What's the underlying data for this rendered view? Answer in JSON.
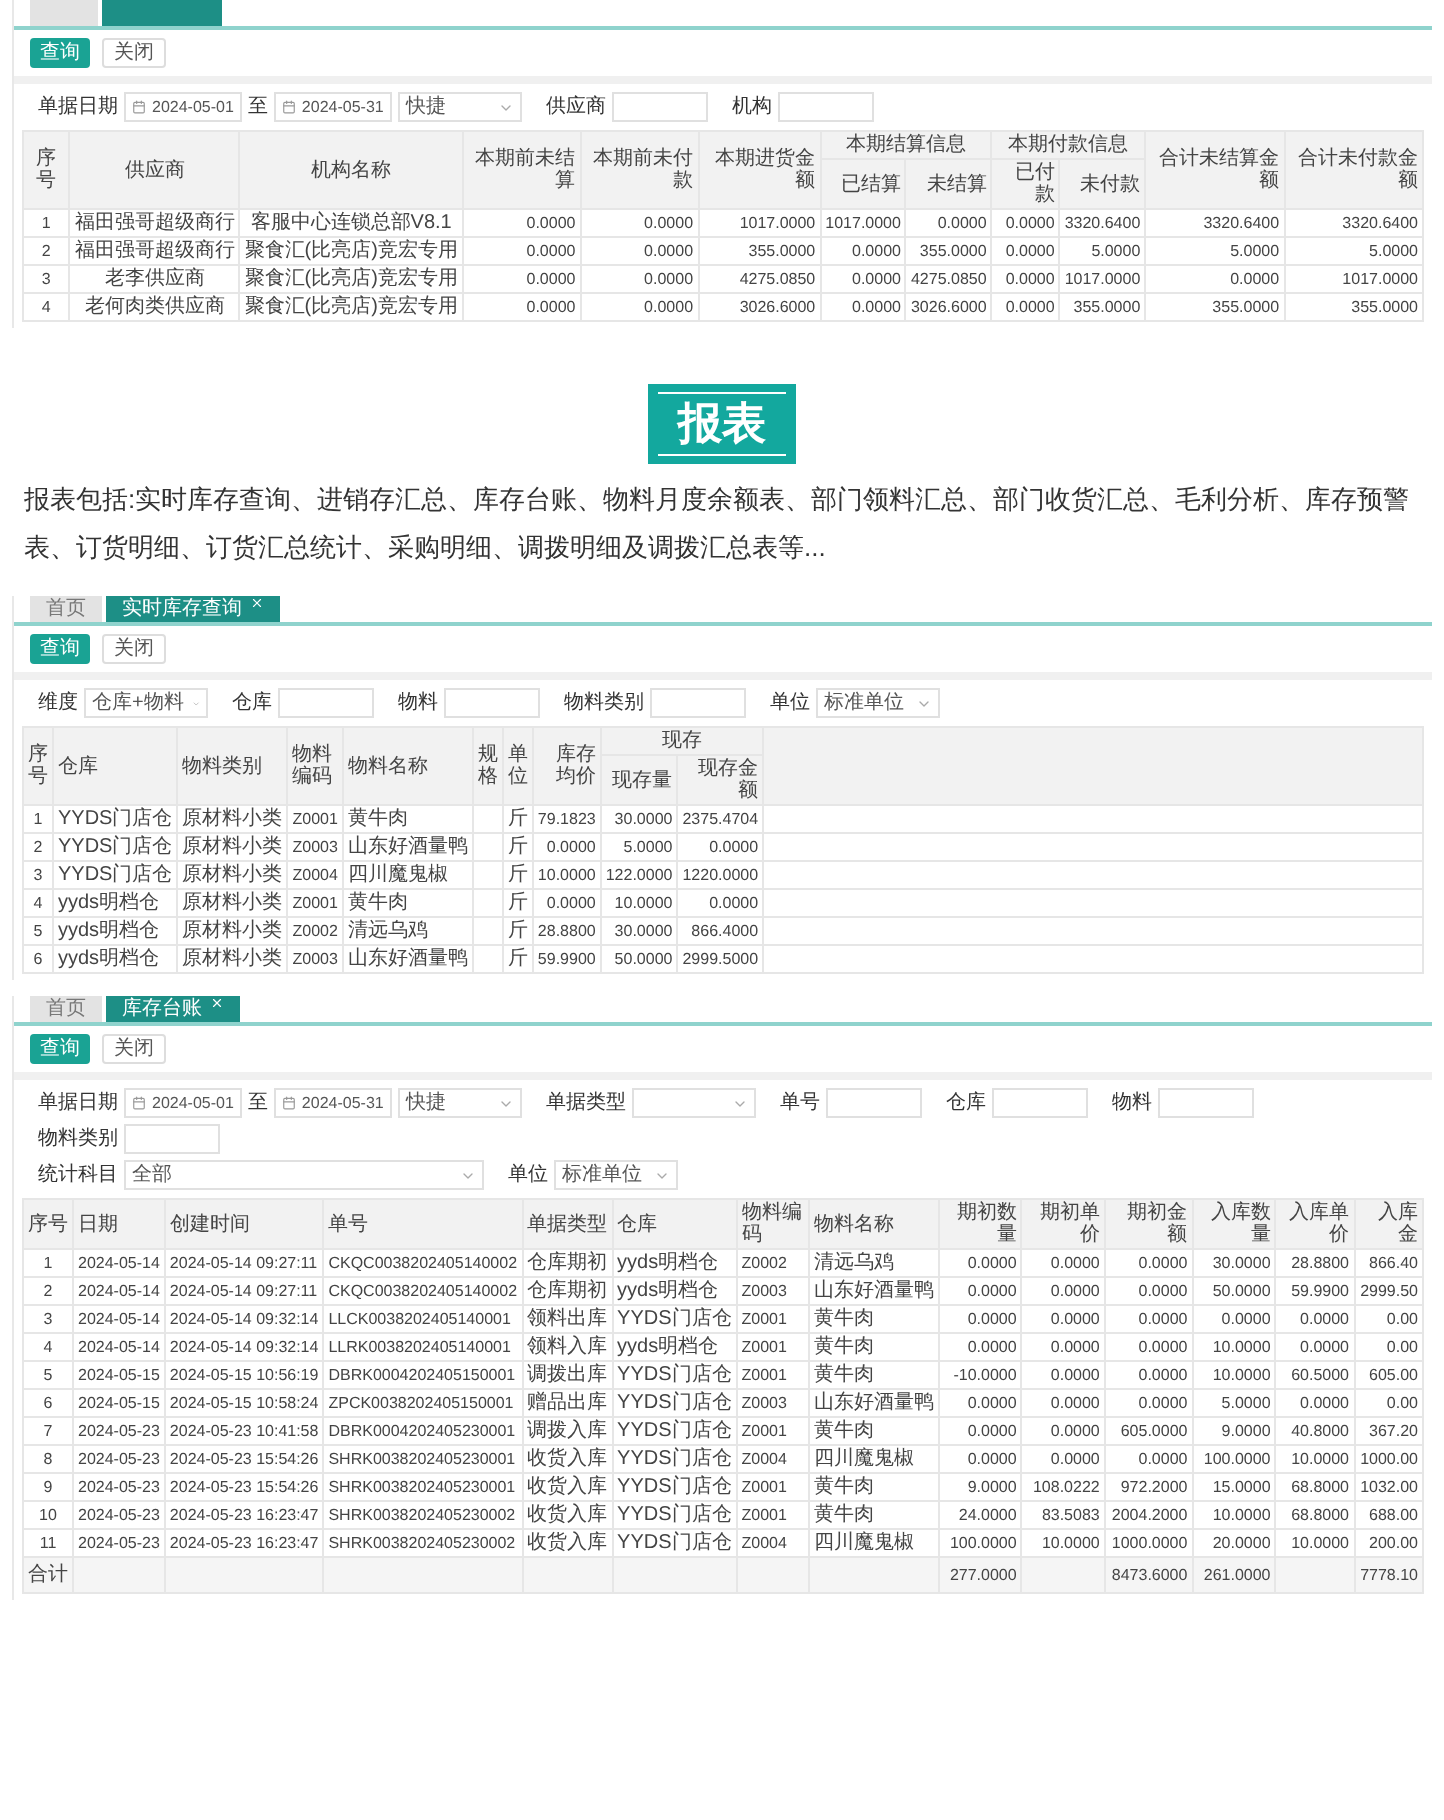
{
  "screens": [
    {
      "tabs": [
        {
          "selected": false,
          "closable": false
        },
        {
          "selected": true,
          "closable": false
        }
      ],
      "buttons": [
        {
          "label": "查询",
          "primary": true
        },
        {
          "label": "关闭",
          "primary": false
        }
      ],
      "filters": [
        [
          {
            "kind": "date_range",
            "label": "单据日期",
            "from": "2024-05-01",
            "to_label": "至",
            "to": "2024-05-31",
            "quick": "快捷"
          },
          {
            "kind": "input",
            "label": "供应商"
          },
          {
            "kind": "input",
            "label": "机构"
          }
        ]
      ],
      "table": {
        "centered": true,
        "filler_column": false,
        "total_row": false,
        "column_groups": [
          {
            "label": "本期结算信息"
          },
          {
            "label": "本期付款信息"
          }
        ],
        "columns": [
          {
            "label": "序号",
            "grouped": false
          },
          {
            "label": "供应商",
            "grouped": false
          },
          {
            "label": "机构名称",
            "grouped": false
          },
          {
            "label": "本期前未结算",
            "grouped": false
          },
          {
            "label": "本期前未付款",
            "grouped": false
          },
          {
            "label": "本期进货金额",
            "grouped": false
          },
          {
            "label": "已结算",
            "grouped": true,
            "group_start": true
          },
          {
            "label": "未结算",
            "grouped": true,
            "group_start": false
          },
          {
            "label": "已付款",
            "grouped": true,
            "group_start": true
          },
          {
            "label": "未付款",
            "grouped": true,
            "group_start": false
          },
          {
            "label": "合计未结算金额",
            "grouped": false
          },
          {
            "label": "合计未付款金额",
            "grouped": false
          }
        ],
        "rows": [
          [
            "1",
            "福田强哥超级商行",
            "客服中心连锁总部V8.1",
            "0.0000",
            "0.0000",
            "1017.0000",
            "1017.0000",
            "0.0000",
            "0.0000",
            "3320.6400",
            "3320.6400",
            "3320.6400"
          ],
          [
            "2",
            "福田强哥超级商行",
            "聚食汇(比亮店)竞宏专用",
            "0.0000",
            "0.0000",
            "355.0000",
            "0.0000",
            "355.0000",
            "0.0000",
            "5.0000",
            "5.0000",
            "5.0000"
          ],
          [
            "3",
            "老李供应商",
            "聚食汇(比亮店)竞宏专用",
            "0.0000",
            "0.0000",
            "4275.0850",
            "0.0000",
            "4275.0850",
            "0.0000",
            "1017.0000",
            "0.0000",
            "1017.0000"
          ],
          [
            "4",
            "老何肉类供应商",
            "聚食汇(比亮店)竞宏专用",
            "0.0000",
            "0.0000",
            "3026.6000",
            "0.0000",
            "3026.6000",
            "0.0000",
            "355.0000",
            "355.0000",
            "355.0000"
          ]
        ]
      }
    },
    {
      "heading": "报表",
      "text": "报表包括:实时库存查询、进销存汇总、库存台账、物料月度余额表、部门领料汇总、部门收货汇总、毛利分析、库存预警表、订货明细、订货汇总统计、采购明细、调拨明细及调拨汇总表等..."
    },
    {
      "tabs": [
        {
          "label": "首页",
          "selected": false,
          "closable": false
        },
        {
          "label": "实时库存查询",
          "selected": true,
          "closable": true
        }
      ],
      "buttons": [
        {
          "label": "查询",
          "primary": true
        },
        {
          "label": "关闭",
          "primary": false
        }
      ],
      "filters": [
        [
          {
            "kind": "select",
            "label": "维度",
            "value": "仓库+物料",
            "wide": false
          },
          {
            "kind": "input",
            "label": "仓库"
          },
          {
            "kind": "input",
            "label": "物料"
          },
          {
            "kind": "input",
            "label": "物料类别"
          },
          {
            "kind": "select",
            "label": "单位",
            "value": "标准单位",
            "wide": false
          }
        ]
      ],
      "table": {
        "centered": false,
        "filler_column": true,
        "total_row": false,
        "column_groups": [
          {
            "label": "现存"
          }
        ],
        "columns": [
          {
            "label": "序号",
            "grouped": false
          },
          {
            "label": "仓库",
            "grouped": false
          },
          {
            "label": "物料类别",
            "grouped": false
          },
          {
            "label": "物料编码",
            "grouped": false
          },
          {
            "label": "物料名称",
            "grouped": false
          },
          {
            "label": "规格",
            "grouped": false
          },
          {
            "label": "单位",
            "grouped": false
          },
          {
            "label": "库存均价",
            "grouped": false
          },
          {
            "label": "现存量",
            "grouped": true,
            "group_start": true
          },
          {
            "label": "现存金额",
            "grouped": true,
            "group_start": false
          }
        ],
        "rows": [
          [
            "1",
            "YYDS门店仓",
            "原材料小类",
            "Z0001",
            "黄牛肉",
            null,
            "斤",
            "79.1823",
            "30.0000",
            "2375.4704"
          ],
          [
            "2",
            "YYDS门店仓",
            "原材料小类",
            "Z0003",
            "山东好酒量鸭",
            null,
            "斤",
            "0.0000",
            "5.0000",
            "0.0000"
          ],
          [
            "3",
            "YYDS门店仓",
            "原材料小类",
            "Z0004",
            "四川魔鬼椒",
            null,
            "斤",
            "10.0000",
            "122.0000",
            "1220.0000"
          ],
          [
            "4",
            "yyds明档仓",
            "原材料小类",
            "Z0001",
            "黄牛肉",
            null,
            "斤",
            "0.0000",
            "10.0000",
            "0.0000"
          ],
          [
            "5",
            "yyds明档仓",
            "原材料小类",
            "Z0002",
            "清远乌鸡",
            null,
            "斤",
            "28.8800",
            "30.0000",
            "866.4000"
          ],
          [
            "6",
            "yyds明档仓",
            "原材料小类",
            "Z0003",
            "山东好酒量鸭",
            null,
            "斤",
            "59.9900",
            "50.0000",
            "2999.5000"
          ]
        ]
      }
    },
    {
      "tabs": [
        {
          "label": "首页",
          "selected": false,
          "closable": false
        },
        {
          "label": "库存台账",
          "selected": true,
          "closable": true
        }
      ],
      "buttons": [
        {
          "label": "查询",
          "primary": true
        },
        {
          "label": "关闭",
          "primary": false
        }
      ],
      "filters": [
        [
          {
            "kind": "date_range",
            "label": "单据日期",
            "from": "2024-05-01",
            "to_label": "至",
            "to": "2024-05-31",
            "quick": "快捷"
          },
          {
            "kind": "select",
            "label": "单据类型",
            "wide": false
          },
          {
            "kind": "input",
            "label": "单号"
          },
          {
            "kind": "input",
            "label": "仓库"
          },
          {
            "kind": "input",
            "label": "物料"
          },
          {
            "kind": "input",
            "label": "物料类别"
          }
        ],
        [
          {
            "kind": "select",
            "label": "统计科目",
            "value": "全部",
            "wide": true
          },
          {
            "kind": "select",
            "label": "单位",
            "value": "标准单位",
            "wide": false
          }
        ]
      ],
      "table": {
        "centered": false,
        "filler_column": false,
        "total_row": true,
        "columns": [
          {
            "label": "序号",
            "grouped": false
          },
          {
            "label": "日期",
            "grouped": false
          },
          {
            "label": "创建时间",
            "grouped": false
          },
          {
            "label": "单号",
            "grouped": false
          },
          {
            "label": "单据类型",
            "grouped": false
          },
          {
            "label": "仓库",
            "grouped": false
          },
          {
            "label": "物料编码",
            "grouped": false
          },
          {
            "label": "物料名称",
            "grouped": false
          },
          {
            "label": "期初数量",
            "grouped": false
          },
          {
            "label": "期初单价",
            "grouped": false
          },
          {
            "label": "期初金额",
            "grouped": false
          },
          {
            "label": "入库数量",
            "grouped": false
          },
          {
            "label": "入库单价",
            "grouped": false
          },
          {
            "label": "入库金",
            "grouped": false
          }
        ],
        "rows": [
          [
            "1",
            "2024-05-14",
            "2024-05-14 09:27:11",
            "CKQC0038202405140002",
            "仓库期初",
            "yyds明档仓",
            "Z0002",
            "清远乌鸡",
            "0.0000",
            "0.0000",
            "0.0000",
            "30.0000",
            "28.8800",
            "866.40"
          ],
          [
            "2",
            "2024-05-14",
            "2024-05-14 09:27:11",
            "CKQC0038202405140002",
            "仓库期初",
            "yyds明档仓",
            "Z0003",
            "山东好酒量鸭",
            "0.0000",
            "0.0000",
            "0.0000",
            "50.0000",
            "59.9900",
            "2999.50"
          ],
          [
            "3",
            "2024-05-14",
            "2024-05-14 09:32:14",
            "LLCK0038202405140001",
            "领料出库",
            "YYDS门店仓",
            "Z0001",
            "黄牛肉",
            "0.0000",
            "0.0000",
            "0.0000",
            "0.0000",
            "0.0000",
            "0.00"
          ],
          [
            "4",
            "2024-05-14",
            "2024-05-14 09:32:14",
            "LLRK0038202405140001",
            "领料入库",
            "yyds明档仓",
            "Z0001",
            "黄牛肉",
            "0.0000",
            "0.0000",
            "0.0000",
            "10.0000",
            "0.0000",
            "0.00"
          ],
          [
            "5",
            "2024-05-15",
            "2024-05-15 10:56:19",
            "DBRK0004202405150001",
            "调拨出库",
            "YYDS门店仓",
            "Z0001",
            "黄牛肉",
            "-10.0000",
            "0.0000",
            "0.0000",
            "10.0000",
            "60.5000",
            "605.00"
          ],
          [
            "6",
            "2024-05-15",
            "2024-05-15 10:58:24",
            "ZPCK0038202405150001",
            "赠品出库",
            "YYDS门店仓",
            "Z0003",
            "山东好酒量鸭",
            "0.0000",
            "0.0000",
            "0.0000",
            "5.0000",
            "0.0000",
            "0.00"
          ],
          [
            "7",
            "2024-05-23",
            "2024-05-23 10:41:58",
            "DBRK0004202405230001",
            "调拨入库",
            "YYDS门店仓",
            "Z0001",
            "黄牛肉",
            "0.0000",
            "0.0000",
            "605.0000",
            "9.0000",
            "40.8000",
            "367.20"
          ],
          [
            "8",
            "2024-05-23",
            "2024-05-23 15:54:26",
            "SHRK0038202405230001",
            "收货入库",
            "YYDS门店仓",
            "Z0004",
            "四川魔鬼椒",
            "0.0000",
            "0.0000",
            "0.0000",
            "100.0000",
            "10.0000",
            "1000.00"
          ],
          [
            "9",
            "2024-05-23",
            "2024-05-23 15:54:26",
            "SHRK0038202405230001",
            "收货入库",
            "YYDS门店仓",
            "Z0001",
            "黄牛肉",
            "9.0000",
            "108.0222",
            "972.2000",
            "15.0000",
            "68.8000",
            "1032.00"
          ],
          [
            "10",
            "2024-05-23",
            "2024-05-23 16:23:47",
            "SHRK0038202405230002",
            "收货入库",
            "YYDS门店仓",
            "Z0001",
            "黄牛肉",
            "24.0000",
            "83.5083",
            "2004.2000",
            "10.0000",
            "68.8000",
            "688.00"
          ],
          [
            "11",
            "2024-05-23",
            "2024-05-23 16:23:47",
            "SHRK0038202405230002",
            "收货入库",
            "YYDS门店仓",
            "Z0004",
            "四川魔鬼椒",
            "100.0000",
            "10.0000",
            "1000.0000",
            "20.0000",
            "10.0000",
            "200.00"
          ],
          [
            "合计",
            null,
            null,
            null,
            null,
            null,
            null,
            null,
            "277.0000",
            null,
            "8473.6000",
            "261.0000",
            null,
            "7778.10"
          ]
        ]
      }
    }
  ]
}
